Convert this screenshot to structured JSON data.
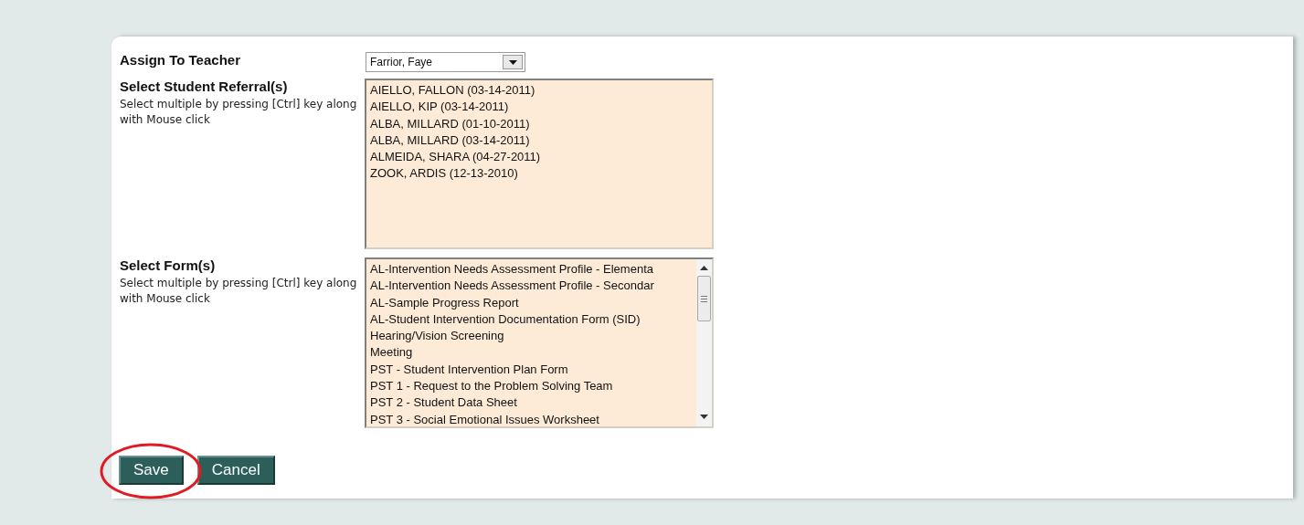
{
  "teacher": {
    "label": "Assign To Teacher",
    "value": "Farrior, Faye"
  },
  "referrals": {
    "label": "Select Student Referral(s)",
    "hint": "Select multiple by pressing [Ctrl] key along with Mouse click",
    "items": [
      "AIELLO, FALLON (03-14-2011)",
      "AIELLO, KIP (03-14-2011)",
      "ALBA, MILLARD (01-10-2011)",
      "ALBA, MILLARD (03-14-2011)",
      "ALMEIDA, SHARA (04-27-2011)",
      "ZOOK, ARDIS (12-13-2010)"
    ]
  },
  "forms": {
    "label": "Select Form(s)",
    "hint": "Select multiple by pressing [Ctrl] key along with Mouse click",
    "items": [
      "AL-Intervention Needs Assessment Profile - Elementa",
      "AL-Intervention Needs Assessment Profile - Secondar",
      "AL-Sample Progress Report",
      "AL-Student Intervention Documentation Form (SID)",
      "Hearing/Vision Screening",
      "Meeting",
      "PST - Student Intervention Plan Form",
      "PST 1 - Request to the Problem Solving Team",
      "PST 2 - Student Data Sheet",
      "PST 3 - Social Emotional Issues Worksheet"
    ]
  },
  "buttons": [
    "Save",
    "Cancel"
  ]
}
